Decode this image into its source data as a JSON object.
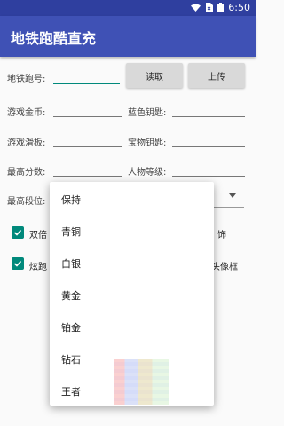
{
  "status_bar": {
    "time": "6:50"
  },
  "app_bar": {
    "title": "地铁跑酷直充"
  },
  "form": {
    "subway_id_label": "地铁跑号:",
    "subway_id_value": "",
    "read_button": "读取",
    "upload_button": "上传",
    "game_coins_label": "游戏金币:",
    "game_coins_value": "",
    "blue_keys_label": "蓝色钥匙:",
    "blue_keys_value": "",
    "game_boards_label": "游戏滑板:",
    "game_boards_value": "",
    "treasure_keys_label": "宝物钥匙:",
    "treasure_keys_value": "",
    "high_score_label": "最高分数:",
    "high_score_value": "",
    "character_level_label": "人物等级:",
    "character_level_value": "",
    "highest_rank_label": "最高段位:"
  },
  "checkboxes": [
    {
      "label_left": "双倍",
      "label_right": "饰",
      "checked": true
    },
    {
      "label_left": "炫跑",
      "label_right": "头像框",
      "checked": true
    }
  ],
  "dropdown": {
    "options": [
      "保持",
      "青铜",
      "白银",
      "黄金",
      "铂金",
      "钻石",
      "王者"
    ]
  },
  "colors": {
    "status_bar": "#2f3f9f",
    "app_bar": "#3f51b5",
    "accent": "#00897b"
  }
}
